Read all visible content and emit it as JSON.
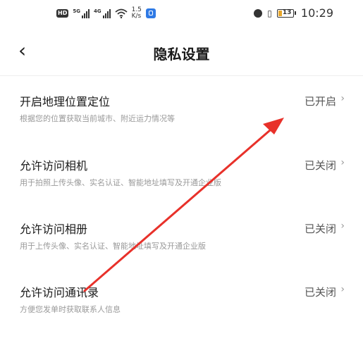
{
  "status_bar": {
    "hd_badge": "HD",
    "signal_1_gen": "5G",
    "signal_2_gen": "4G",
    "net_speed_value": "1.5",
    "net_speed_unit": "K/s",
    "battery_level": "13",
    "time": "10:29"
  },
  "header": {
    "back_symbol": "‹",
    "title": "隐私设置"
  },
  "settings": [
    {
      "title": "开启地理位置定位",
      "desc": "根据您的位置获取当前城市、附近运力情况等",
      "status": "已开启"
    },
    {
      "title": "允许访问相机",
      "desc": "用于拍照上传头像、实名认证、智能地址填写及开通企业版",
      "status": "已关闭"
    },
    {
      "title": "允许访问相册",
      "desc": "用于上传头像、实名认证、智能地址填写及开通企业版",
      "status": "已关闭"
    },
    {
      "title": "允许访问通讯录",
      "desc": "方便您发单时获取联系人信息",
      "status": "已关闭"
    }
  ],
  "chevron": "›",
  "colors": {
    "annotation_arrow": "#e8312a",
    "battery_fill": "#e8a72b",
    "app_icon": "#2f7ae5"
  }
}
